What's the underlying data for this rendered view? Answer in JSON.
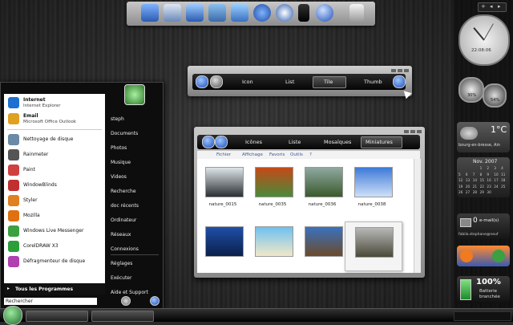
{
  "start_menu": {
    "pinned": [
      {
        "title": "Internet",
        "subtitle": "Internet Explorer",
        "icon": "internet-explorer-icon",
        "color": "#1e6fd0"
      },
      {
        "title": "Email",
        "subtitle": "Microsoft Office Outlook",
        "icon": "outlook-icon",
        "color": "#e0a020"
      }
    ],
    "recent": [
      {
        "label": "Nettoyage de disque",
        "icon": "disk-cleanup-icon",
        "color": "#6a8aa8"
      },
      {
        "label": "Rainmeter",
        "icon": "rainmeter-icon",
        "color": "#555555"
      },
      {
        "label": "Paint",
        "icon": "paint-icon",
        "color": "#d04040"
      },
      {
        "label": "WindowBlinds",
        "icon": "windowblinds-icon",
        "color": "#c03030"
      },
      {
        "label": "Styler",
        "icon": "styler-icon",
        "color": "#e08020"
      },
      {
        "label": "Mozilla",
        "icon": "firefox-icon",
        "color": "#e07010"
      },
      {
        "label": "Windows Live Messenger",
        "icon": "messenger-icon",
        "color": "#3aa040"
      },
      {
        "label": "CorelDRAW X3",
        "icon": "coreldraw-icon",
        "color": "#2c9e3a"
      },
      {
        "label": "Défragmenteur de disque",
        "icon": "defrag-icon",
        "color": "#b040b0"
      }
    ],
    "all_programs": "Tous les Programmes",
    "search_placeholder": "Rechercher",
    "right_items": [
      "steph",
      "Documents",
      "Photos",
      "Musique",
      "Videos",
      "Recherche",
      "doc récents",
      "Ordinateur",
      "Réseaux",
      "Connexions",
      "Réglages",
      "Exécuter",
      "Aide et Support"
    ]
  },
  "toolbar_window": {
    "items": [
      "Icon",
      "List",
      "Tile",
      "Thumb"
    ],
    "active": "Tile"
  },
  "explorer": {
    "tabs": [
      "Icônes",
      "Liste",
      "Mosaïques",
      "Miniatures"
    ],
    "active_tab": "Miniatures",
    "menu": [
      "Fichier",
      "Affichage",
      "Favoris",
      "Outils",
      "?"
    ],
    "thumbnails": [
      {
        "label": "nature_0015",
        "colors": [
          "#dfe6ea",
          "#2a2f33"
        ]
      },
      {
        "label": "nature_0035",
        "colors": [
          "#c44a18",
          "#4a8a3a"
        ]
      },
      {
        "label": "nature_0036",
        "colors": [
          "#8fa8a0",
          "#3a5a2c"
        ]
      },
      {
        "label": "nature_0038",
        "colors": [
          "#3d7ad8",
          "#cfe0f8"
        ]
      },
      {
        "label": "",
        "colors": [
          "#1f4fa8",
          "#0b1f4a"
        ]
      },
      {
        "label": "",
        "colors": [
          "#6fc0f0",
          "#f2e8c8"
        ]
      },
      {
        "label": "",
        "colors": [
          "#3a72c0",
          "#6b4a2a"
        ]
      },
      {
        "label": "",
        "colors": [
          "#b8b8b8",
          "#4a4a3a"
        ]
      }
    ]
  },
  "gadgets": {
    "clock_time": "22:08:06",
    "weather_temp": "1°C",
    "weather_city": "bourg-en-bresse, Ain",
    "calendar_month": "Nov. 2007",
    "calendar_days": [
      "",
      "",
      "",
      "1",
      "2",
      "3",
      "4",
      "5",
      "6",
      "7",
      "8",
      "9",
      "10",
      "11",
      "12",
      "13",
      "14",
      "15",
      "16",
      "17",
      "18",
      "19",
      "20",
      "21",
      "22",
      "23",
      "24",
      "25",
      "26",
      "27",
      "28",
      "29",
      "30",
      "",
      ""
    ],
    "mail_count": "0",
    "mail_label": "e-mail(s)",
    "mail_address": "fabila.stephane@neuf",
    "battery_percent": "100%",
    "battery_label_1": "Batterie",
    "battery_label_2": "branchée",
    "meter_1": "30%",
    "meter_2": "54%"
  },
  "dock_icons": [
    "computer-icon",
    "laptop-icon",
    "word-icon",
    "folder-icon",
    "music-icon",
    "firefox-icon",
    "messenger-icon",
    "ipod-icon",
    "media-player-icon",
    "recycle-bin-icon"
  ],
  "colors": {
    "accent_blue": "#1d4fb8",
    "desktop_dark": "#1e1e1e",
    "window_silver": "#c8c8c8"
  }
}
